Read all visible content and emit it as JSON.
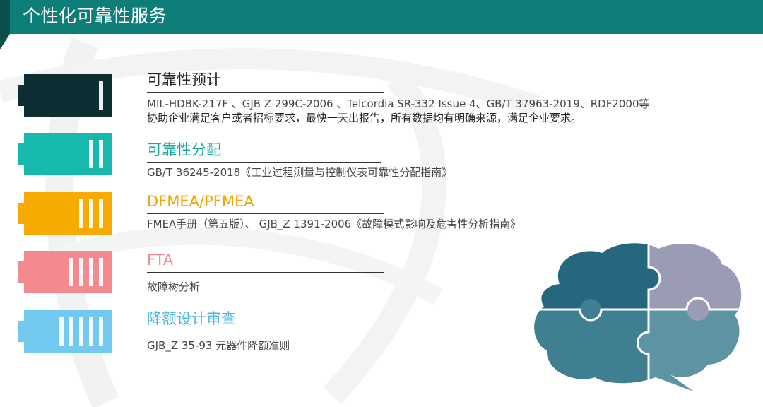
{
  "header": {
    "title": "个性化可靠性服务",
    "color": "#0e7f78"
  },
  "items": [
    {
      "title": "可靠性预计",
      "title_color": "#222222",
      "battery_color": "#0c2f33",
      "level": 1,
      "desc": "MIL-HDBK-217F 、GJB Z 299C-2006 、Telcordia SR-332 Issue 4、GB/T 37963-2019、RDF2000等",
      "desc2": "协助企业满足客户或者招标要求，最快一天出报告，所有数据均有明确来源，满足企业要求。"
    },
    {
      "title": "可靠性分配",
      "title_color": "#1aa99c",
      "battery_color": "#17b8ad",
      "level": 2,
      "desc": "GB/T 36245-2018《工业过程测量与控制仪表可靠性分配指南》"
    },
    {
      "title": "DFMEA/PFMEA",
      "title_color": "#f5a300",
      "battery_color": "#f7ab00",
      "level": 3,
      "desc": "FMEA手册（第五版）、 GJB_Z 1391-2006《故障模式影响及危害性分析指南》"
    },
    {
      "title": "FTA",
      "title_color": "#f2858d",
      "battery_color": "#f48a90",
      "level": 4,
      "desc": "故障树分析"
    },
    {
      "title": "降额设计审查",
      "title_color": "#55b8e0",
      "battery_color": "#72c8ee",
      "level": 5,
      "desc": "GJB_Z 35-93 元器件降额准则"
    }
  ],
  "graphic": {
    "icon": "brain-puzzle-icon",
    "colors": [
      "#25677e",
      "#9a9cb5",
      "#3f7f91",
      "#5e93a4"
    ]
  }
}
